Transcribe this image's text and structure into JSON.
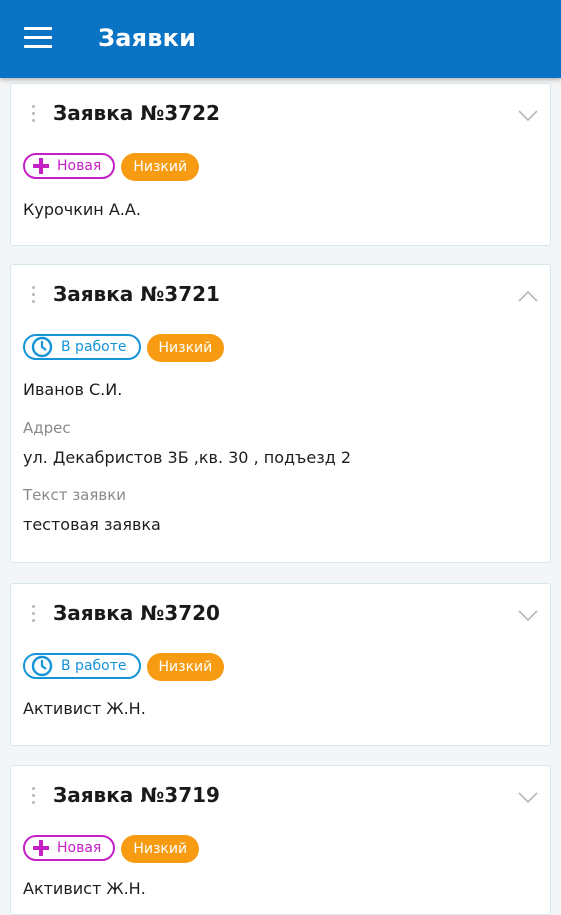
{
  "appbar": {
    "title": "Заявки",
    "menu_icon": "menu-icon"
  },
  "requests": [
    {
      "title": "Заявка №3722",
      "status": "Новая",
      "priority": "Низкий",
      "person": "Курочкин А.А.",
      "expanded": false
    },
    {
      "title": "Заявка №3721",
      "status": "В работе",
      "priority": "Низкий",
      "person": "Иванов С.И.",
      "expanded": true,
      "address_label": "Адрес",
      "address": "ул. Декабристов 3Б ,кв. 30 , подъезд 2",
      "text_label": "Текст заявки",
      "text": "тестовая заявка"
    },
    {
      "title": "Заявка №3720",
      "status": "В работе",
      "priority": "Низкий",
      "person": "Активист Ж.Н.",
      "expanded": false
    },
    {
      "title": "Заявка №3719",
      "status": "Новая",
      "priority": "Низкий",
      "person": "Активист Ж.Н.",
      "expanded": false
    }
  ],
  "colors": {
    "appbar": "#0a73c4",
    "status_new": "#c51fc8",
    "status_in_work": "#1594d8",
    "priority_low": "#f79b12"
  }
}
